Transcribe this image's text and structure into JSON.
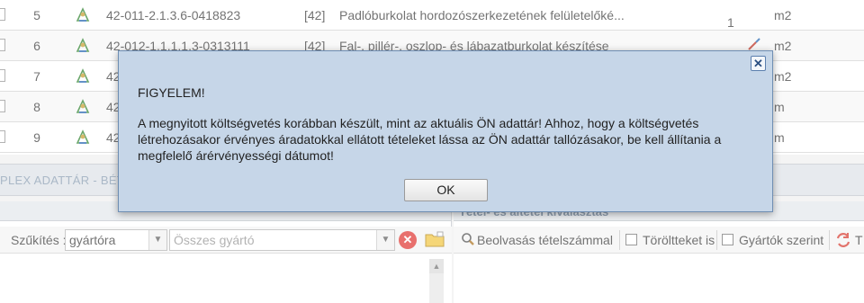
{
  "table": {
    "rows": [
      {
        "num": "5",
        "code": "42-011-2.1.3.6-0418823",
        "group": "[42]",
        "description": "Padlóburkolat hordozószerkezetének felületelőké...",
        "quantity": "1",
        "unit": "m2"
      },
      {
        "num": "6",
        "code": "42-012-1.1.1.1.3-0313111",
        "group": "[42]",
        "description": "Fal-, pillér-, oszlop- és lábazatburkolat készítése",
        "quantity": "",
        "unit": "m2"
      },
      {
        "num": "7",
        "code": "42",
        "group": "",
        "description": "",
        "quantity": "",
        "unit": "m2"
      },
      {
        "num": "8",
        "code": "42",
        "group": "",
        "description": "",
        "quantity": "",
        "unit": "m"
      },
      {
        "num": "9",
        "code": "42",
        "group": "",
        "description": "",
        "quantity": "",
        "unit": "m"
      }
    ]
  },
  "section": {
    "title": "PLEX ADATTÁR - BÉTA"
  },
  "left_panel": {
    "filter_label": "Szűkítés :",
    "filter_type_value": "gyártóra",
    "manufacturer_placeholder": "Összes gyártó"
  },
  "right_panel": {
    "header": "Tétel- és altétel kiválasztás",
    "read_with_items": "Beolvasás tételszámmal",
    "deleted_label": "Töröltteket is",
    "by_manufacturer_label": "Gyártók szerint",
    "trailing_label": "T"
  },
  "dialog": {
    "heading": "FIGYELEM!",
    "message": "A megnyitott költségvetés korábban készült, mint az aktuális ÖN adattár! Ahhoz, hogy a költségvetés létrehozásakor érvényes áradatokkal ellátott tételeket lássa az ÖN adattár tallózásakor, be kell állítania a megfelelő árérvényességi dátumot!",
    "ok_label": "OK",
    "close_symbol": "✕"
  },
  "colors": {
    "dialog_bg": "#c6d6e8",
    "dialog_border": "#6f8eb3",
    "clear_button": "#e0413d"
  },
  "icons": {
    "row_icon": "recycle-person-icon",
    "clear": "clear-icon",
    "folder": "folder-icon",
    "search": "search-icon",
    "refresh": "refresh-icon"
  }
}
